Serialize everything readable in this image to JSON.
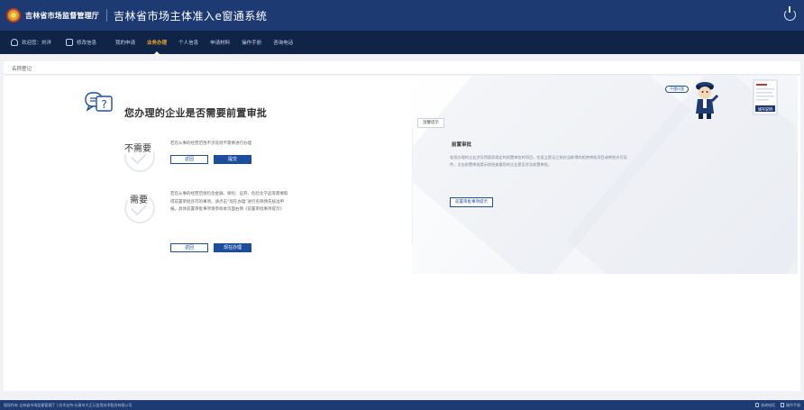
{
  "header": {
    "org_name": "吉林省市场监督管理厅",
    "system_title": "吉林省市场主体准入e窗通系统"
  },
  "nav": {
    "welcome": "欢迎您：刘洋",
    "items": [
      "修改信息",
      "我的申请",
      "业务办理",
      "个人信息",
      "申请材料",
      "操作手册",
      "咨询电话"
    ],
    "active": "业务办理",
    "active_color": "#f0a32a"
  },
  "breadcrumb": "名称登记",
  "question": {
    "title": "您办理的企业是否需要前置审批"
  },
  "option_no": {
    "label": "不需要",
    "desc": "若您从事的经营范围不涉及则不需要进行办理",
    "back_label": "返回",
    "submit_label": "提交"
  },
  "option_yes": {
    "label": "需要",
    "desc": "若您从事的经营范围包含金融、保险、证券、危险化学品等需要取得前置审批许可的事项，请点击“现在办理”进行名称预先核准申报。具体前置审批事项请参阅本页面右侧《前置审批事项提示》",
    "back_label": "返回",
    "now_label": "现在办理"
  },
  "tip_panel": {
    "tag": "温馨提示",
    "heading": "前置审批",
    "body": "若您办理的企业涉及到国家规定的前置审批的项目，在设立登记之前应当取得的相关审批项目或审批许可证件。点击前置审批提示按钮查看您的企业是否涉及前置审批。",
    "button_label": "前置审批事项提示",
    "help_bubble": "不懂问我",
    "guide_label": "填写说明"
  },
  "footer": {
    "copyright": "版权所有 吉林省市场监督管理厅 | 技术支持:长春市大正元信用技术股份有限公司",
    "hotline": "咨询电话",
    "manual": "操作手册"
  },
  "colors": {
    "header_bg": "#1d3a72",
    "nav_bg": "#0f2447",
    "primary": "#1d4e9e",
    "page_bg": "#f0f2f5"
  }
}
